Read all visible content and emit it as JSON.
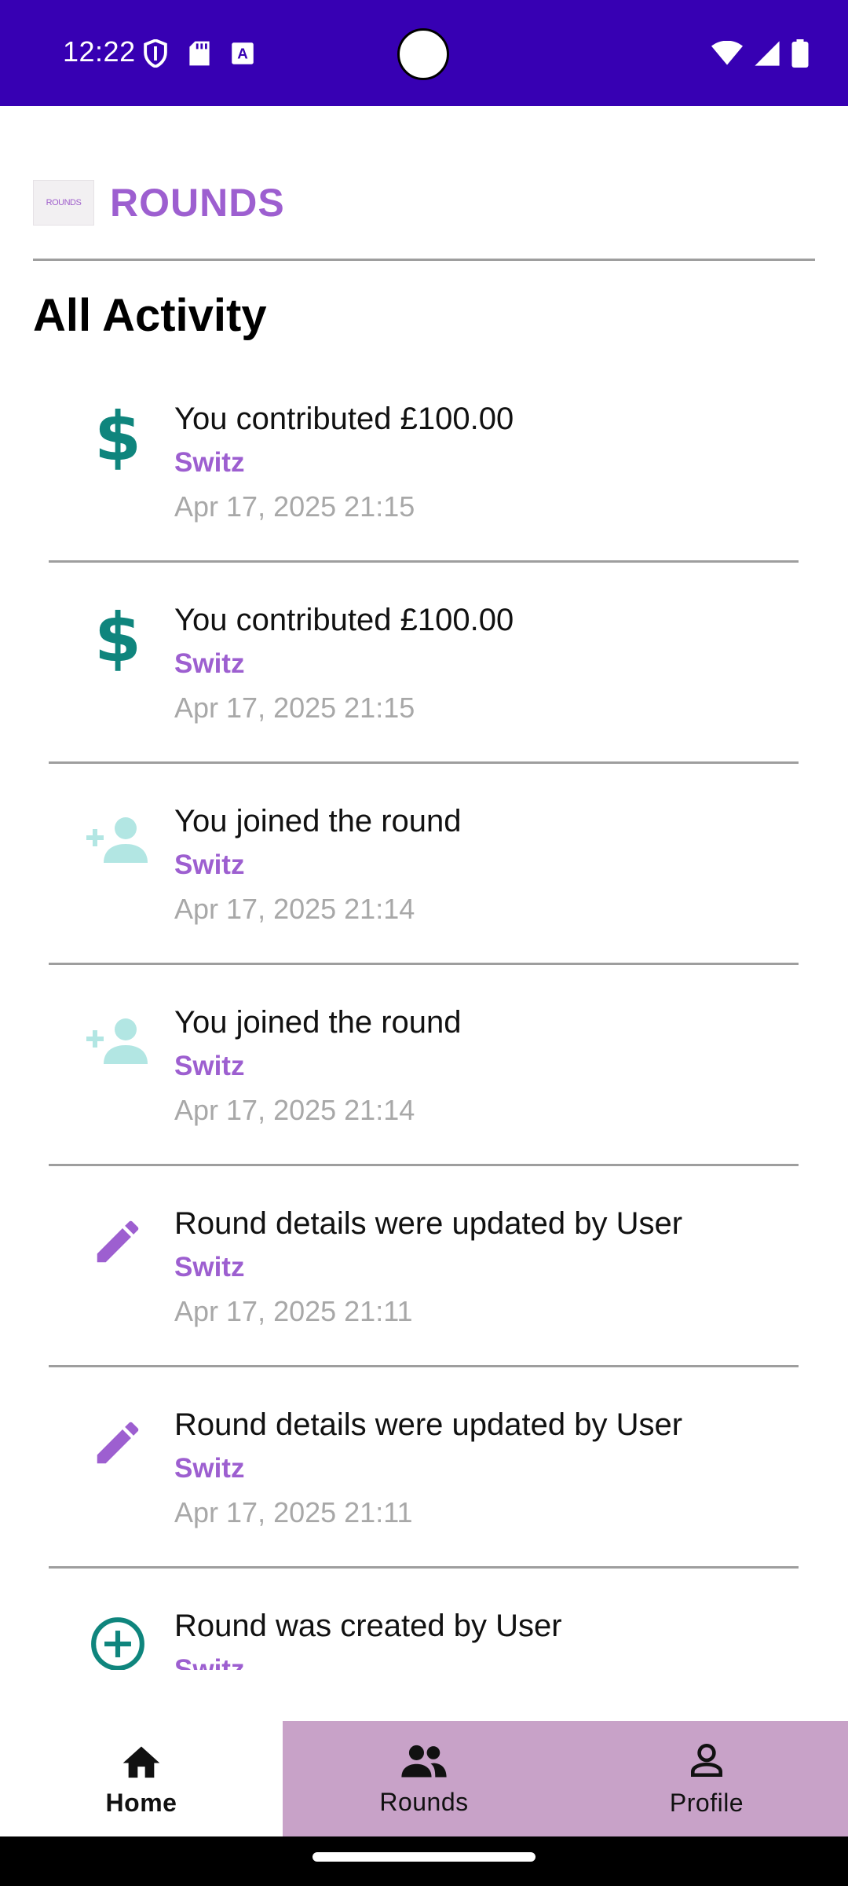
{
  "status_bar": {
    "time": "12:22",
    "icons_left": [
      "shield-icon",
      "sd-card-icon",
      "keyboard-a-icon"
    ],
    "icons_right": [
      "wifi-icon",
      "signal-icon",
      "battery-icon"
    ],
    "background": "#3700b3"
  },
  "header": {
    "logo_text": "ROUNDS",
    "brand": "ROUNDS",
    "brand_color": "#9d5fd0"
  },
  "section_title": "All Activity",
  "activities": [
    {
      "icon": "dollar-icon",
      "title": "You contributed £100.00",
      "round": "Switz",
      "date": "Apr 17, 2025 21:15"
    },
    {
      "icon": "dollar-icon",
      "title": "You contributed £100.00",
      "round": "Switz",
      "date": "Apr 17, 2025 21:15"
    },
    {
      "icon": "person-add-icon",
      "title": "You joined the round",
      "round": "Switz",
      "date": "Apr 17, 2025 21:14"
    },
    {
      "icon": "person-add-icon",
      "title": "You joined the round",
      "round": "Switz",
      "date": "Apr 17, 2025 21:14"
    },
    {
      "icon": "pencil-icon",
      "title": "Round details were updated by User",
      "round": "Switz",
      "date": "Apr 17, 2025 21:11"
    },
    {
      "icon": "pencil-icon",
      "title": "Round details were updated by User",
      "round": "Switz",
      "date": "Apr 17, 2025 21:11"
    },
    {
      "icon": "plus-circle-icon",
      "title": "Round was created by User",
      "round": "Switz",
      "date": ""
    }
  ],
  "bottom_nav": {
    "tabs": [
      {
        "label": "Home",
        "icon": "home-icon",
        "active": true
      },
      {
        "label": "Rounds",
        "icon": "group-icon",
        "active": false
      },
      {
        "label": "Profile",
        "icon": "person-icon",
        "active": false
      }
    ]
  },
  "colors": {
    "teal": "#0f857d",
    "light_teal": "#b2e6e3",
    "purple": "#9d5fd0",
    "nav_inactive": "#c8a2c8"
  }
}
